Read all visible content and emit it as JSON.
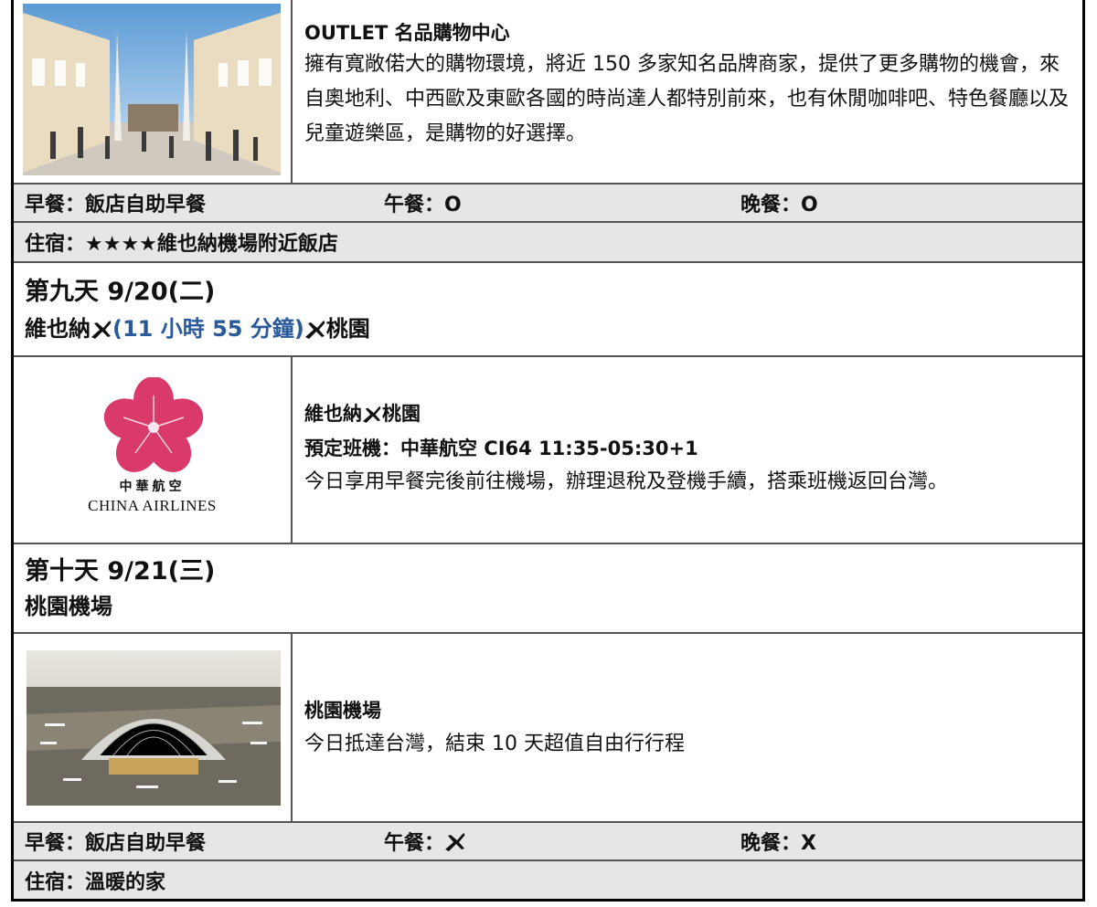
{
  "outlet": {
    "title": "OUTLET 名品購物中心",
    "description": "擁有寬敞偌大的購物環境，將近 150 多家知名品牌商家，提供了更多購物的機會，來自奧地利、中西歐及東歐各國的時尚達人都特別前來，也有休閒咖啡吧、特色餐廳以及兒童遊樂區，是購物的好選擇。"
  },
  "meals_day8": {
    "breakfast": "早餐：飯店自助早餐",
    "lunch": "午餐：O",
    "dinner": "晚餐：O"
  },
  "hotel_day8": "住宿：★★★★維也納機場附近飯店",
  "day9": {
    "title": "第九天 9/20(二)",
    "route_from": "維也納",
    "duration": "(11 小時 55 分鐘)",
    "route_to": "桃園",
    "flight_route_from": "維也納",
    "flight_route_to": "桃園",
    "flight": "預定班機：中華航空 CI64 11:35-05:30+1",
    "description": "今日享用早餐完後前往機場，辦理退稅及登機手續，搭乘班機返回台灣。",
    "logo_chinese": "中華航空",
    "logo_english": "CHINA AIRLINES"
  },
  "day10": {
    "title": "第十天 9/21(三)",
    "subtitle": "桃園機場",
    "place_title": "桃園機場",
    "description": "今日抵達台灣，結束 10 天超值自由行行程"
  },
  "meals_day10": {
    "breakfast": "早餐：飯店自助早餐",
    "lunch": "午餐：",
    "dinner": "晚餐：X"
  },
  "hotel_day10": "住宿：溫暖的家",
  "colors": {
    "gray_row": "#e6e6e6",
    "duration_blue": "#2a5a9a",
    "plum_blossom": "#d93a6a"
  }
}
